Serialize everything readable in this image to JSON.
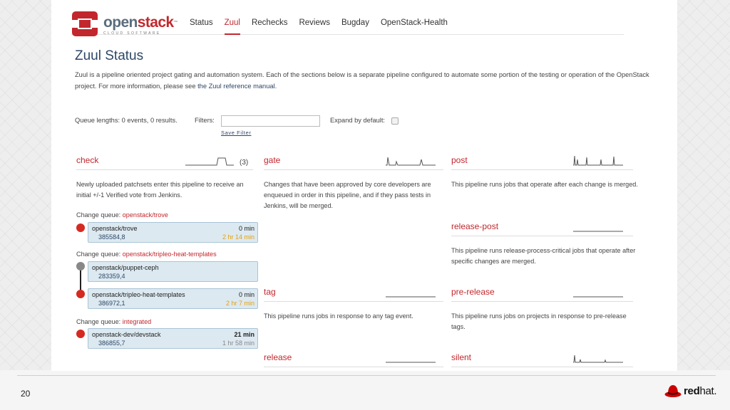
{
  "slide": {
    "number": "20"
  },
  "redhat": {
    "word_bold": "red",
    "word_light": "hat",
    "suffix": "."
  },
  "brand": {
    "name_a": "open",
    "name_b": "stack",
    "tm": "™",
    "sub": "CLOUD SOFTWARE"
  },
  "nav": [
    {
      "label": "Status"
    },
    {
      "label": "Zuul",
      "active": true
    },
    {
      "label": "Rechecks"
    },
    {
      "label": "Reviews"
    },
    {
      "label": "Bugday"
    },
    {
      "label": "OpenStack-Health"
    }
  ],
  "page": {
    "title": "Zuul Status",
    "intro_text": "Zuul is a pipeline oriented project gating and automation system. Each of the sections below is a separate pipeline configured to automate some portion of the testing or operation of the OpenStack project. For more information, please see ",
    "intro_link": "the Zuul reference manual",
    "intro_end": "."
  },
  "controls": {
    "queue_lengths": "Queue lengths: 0 events, 0 results.",
    "filters_label": "Filters:",
    "filters_value": "",
    "save_filter": "Save Filter",
    "expand_label": "Expand by default:"
  },
  "pipelines": {
    "check": {
      "name": "check",
      "count": "(3)",
      "desc": "Newly uploaded patchsets enter this pipeline to receive an initial +/-1 Verified vote from Jenkins."
    },
    "gate": {
      "name": "gate",
      "desc": "Changes that have been approved by core developers are enqueued in order in this pipeline, and if they pass tests in Jenkins, will be merged."
    },
    "post": {
      "name": "post",
      "desc": "This pipeline runs jobs that operate after each change is merged."
    },
    "release_post": {
      "name": "release-post",
      "desc": "This pipeline runs release-process-critical jobs that operate after specific changes are merged."
    },
    "tag": {
      "name": "tag",
      "desc": "This pipeline runs jobs in response to any tag event."
    },
    "pre_release": {
      "name": "pre-release",
      "desc": "This pipeline runs jobs on projects in response to pre-release tags."
    },
    "release": {
      "name": "release"
    },
    "silent": {
      "name": "silent"
    }
  },
  "queues": [
    {
      "label": "Change queue: ",
      "project": "openstack/trove",
      "changes": [
        {
          "project": "openstack/trove",
          "number": "385584,8",
          "time_elapsed": "0 min",
          "time_remaining": "2 hr 14 min"
        }
      ]
    },
    {
      "label": "Change queue: ",
      "project": "openstack/tripleo-heat-templates",
      "changes": [
        {
          "project": "openstack/puppet-ceph",
          "number": "283359,4",
          "time_elapsed": "",
          "time_remaining": ""
        },
        {
          "project": "openstack/tripleo-heat-templates",
          "number": "386972,1",
          "time_elapsed": "0 min",
          "time_remaining": "2 hr 7 min"
        }
      ]
    },
    {
      "label": "Change queue: ",
      "project": "integrated",
      "changes": [
        {
          "project": "openstack-dev/devstack",
          "number": "386855,7",
          "time_elapsed": "21 min",
          "time_remaining": "1 hr 58 min"
        }
      ]
    }
  ],
  "colors": {
    "accent_red": "#c2272d",
    "title_blue": "#2e4766",
    "change_bg": "#dce9f1",
    "eta_orange": "#e6a10a",
    "status_red": "#d42a22",
    "status_grey": "#888888"
  }
}
